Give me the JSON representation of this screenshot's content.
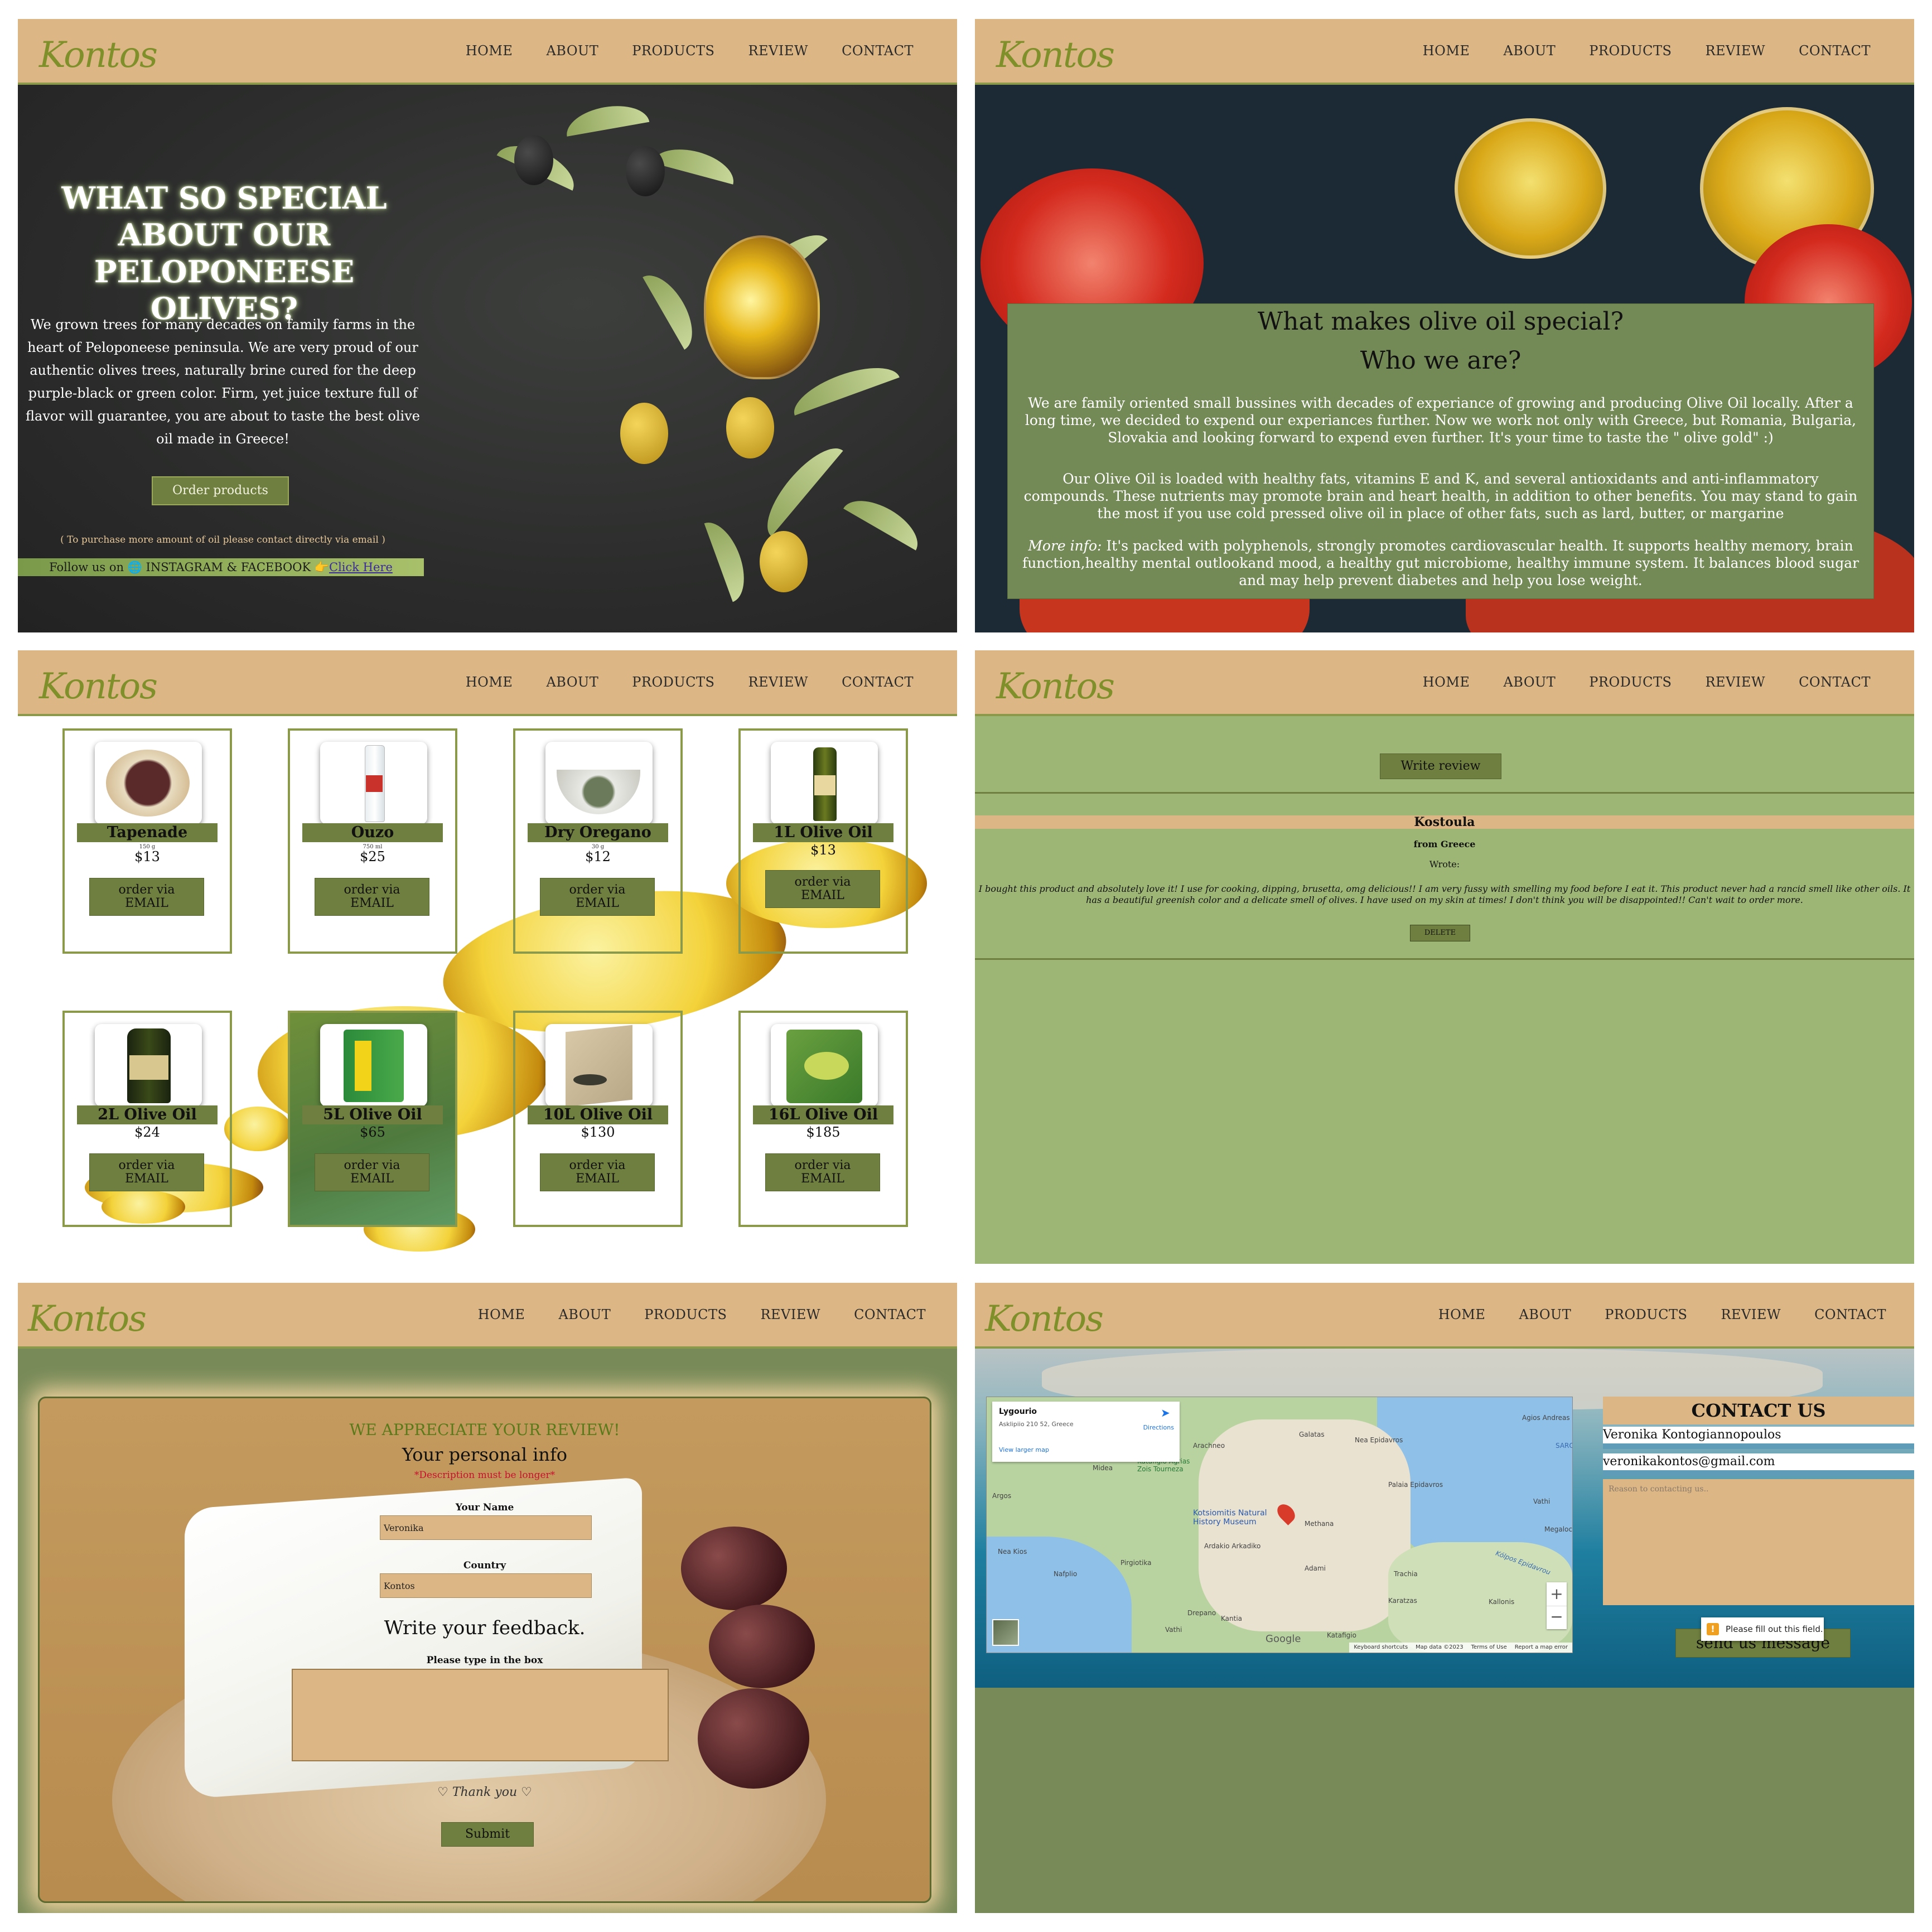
{
  "nav": {
    "items": [
      "HOME",
      "ABOUT",
      "PRODUCTS",
      "REVIEW",
      "CONTACT"
    ]
  },
  "logo": {
    "text": "Kontos"
  },
  "home": {
    "title": "WHAT SO SPECIAL ABOUT OUR PELOPONEESE OLIVES?",
    "text": "We grown trees for many decades on family farms in the heart of Peloponeese peninsula. We are very proud of our authentic olives trees, naturally brine cured for the deep purple-black or green color. Firm, yet juice texture full of flavor will guarantee, you are about to taste the best olive oil made in Greece!",
    "button": "Order products",
    "note": "( To purchase more amount of oil please contact directly via email )",
    "follow_prefix": "Follow us on 🌐 INSTAGRAM & FACEBOOK 👉",
    "follow_link": "Click Here"
  },
  "about": {
    "title1": "What makes olive oil special?",
    "title2": "Who we are?",
    "p1": "We are family oriented small bussines with decades of experiance of growing and producing Olive Oil locally. After a long time, we decided to expend our experiances further. Now we work not only with Greece, but Romania, Bulgaria, Slovakia and looking forward to expend even further. It's your time to taste the \" olive gold\" :)",
    "p2": "Our Olive Oil is loaded with healthy fats, vitamins E and K, and several antioxidants and anti-inflammatory compounds. These nutrients may promote brain and heart health, in addition to other benefits. You may stand to gain the most if you use cold pressed olive oil in place of other fats, such as lard, butter, or margarine",
    "p3_em": "More info:",
    "p3": " It's packed with polyphenols, strongly promotes cardiovascular health. It supports healthy memory, brain function,healthy mental outlookand mood, a healthy gut microbiome, healthy immune system. It balances blood sugar and may help prevent diabetes and help you lose weight."
  },
  "products": [
    {
      "name": "Tapenade",
      "qty": "150 g",
      "price": "$13",
      "order": [
        "order via",
        "EMAIL"
      ]
    },
    {
      "name": "Ouzo",
      "qty": "750 ml",
      "price": "$25",
      "order": [
        "order via",
        "EMAIL"
      ]
    },
    {
      "name": "Dry Oregano",
      "qty": "30 g",
      "price": "$12",
      "order": [
        "order via",
        "EMAIL"
      ]
    },
    {
      "name": "1L Olive Oil",
      "qty": "",
      "price": "$13",
      "order": [
        "order via",
        "EMAIL"
      ]
    },
    {
      "name": "2L Olive Oil",
      "qty": "",
      "price": "$24",
      "order": [
        "order via",
        "EMAIL"
      ]
    },
    {
      "name": "5L Olive Oil",
      "qty": "",
      "price": "$65",
      "order": [
        "order via",
        "EMAIL"
      ]
    },
    {
      "name": "10L Olive Oil",
      "qty": "",
      "price": "$130",
      "order": [
        "order via",
        "EMAIL"
      ]
    },
    {
      "name": "16L Olive Oil",
      "qty": "",
      "price": "$185",
      "order": [
        "order via",
        "EMAIL"
      ]
    }
  ],
  "review": {
    "button": "Write review",
    "name": "Kostoula",
    "from": "from Greece",
    "wrote": "Wrote:",
    "text": "I bought this product and absolutely love it! I use for cooking, dipping, brusetta, omg delicious!! I am very fussy with smelling my food before I eat it. This product never had a rancid smell like other oils. It has a beautiful greenish color and a delicate smell of olives. I have used on my skin at times! I don't think you will be disappointed!! Can't wait to order more.",
    "delete": "DELETE"
  },
  "review_form": {
    "heading": "WE APPRECIATE YOUR REVIEW!",
    "personal": "Your personal info",
    "error": "*Description must be longer*",
    "name_label": "Your Name",
    "name_value": "Veronika",
    "country_label": "Country",
    "country_value": "Kontos",
    "feedback": "Write your feedback.",
    "box_label": "Please type in the box",
    "thanks": "♡ Thank you ♡",
    "submit": "Submit"
  },
  "contact": {
    "heading": "CONTACT US",
    "name_value": "Veronika Kontogiannopoulos",
    "email_value": "veronikakontos@gmail.com",
    "reason_placeholder": "Reason to contacting us..",
    "send": "send us message",
    "tooltip": "Please fill out this field.",
    "map": {
      "place": "Lygourio",
      "address": "Asklipiio 210 52, Greece",
      "directions": "Directions",
      "larger": "View larger map",
      "museum": "Kotsiomitis Natural History Museum",
      "labels": [
        "Arachneo",
        "Midea",
        "Argos",
        "Katafigio Agrias Zois Tourneza",
        "Nea Epidavros",
        "Palaia Epidavros",
        "Ardakio Arkadiko",
        "Pirgiotika",
        "Nea Kios",
        "Nafplio",
        "Adami",
        "Trachia",
        "Karatzas",
        "Kallonis",
        "Kranidi",
        "Katafigio",
        "Galatas",
        "Dimaina",
        "Agios Andreas",
        "Megalochori",
        "Vathi",
        "Methana",
        "Ligourio",
        "Drepano",
        "Tolo",
        "Kantia"
      ],
      "footer": [
        "Keyboard shortcuts",
        "Map data ©2023",
        "Terms of Use",
        "Report a map error"
      ],
      "google": "Google",
      "sea": "SARONIC",
      "gulf": "Kólpos Epidavrou"
    }
  }
}
